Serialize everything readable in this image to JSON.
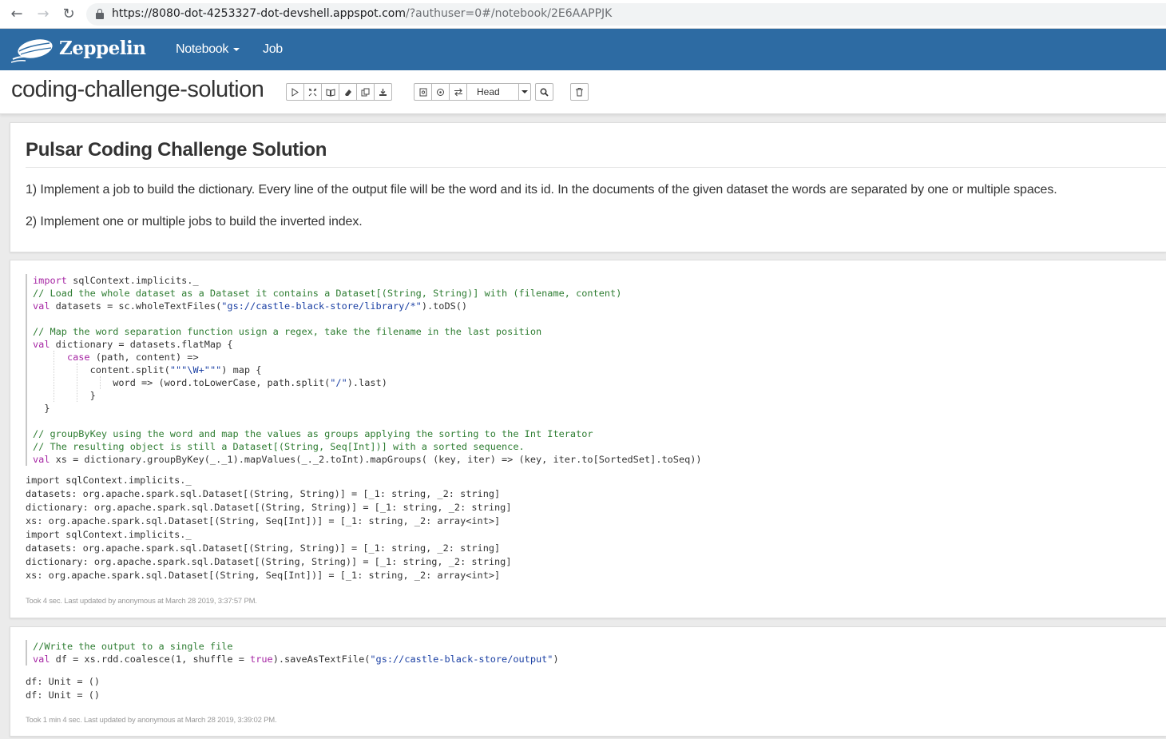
{
  "browser": {
    "url_host": "https://8080-dot-4253327-dot-devshell.appspot.com",
    "url_rest": "/?authuser=0#/notebook/2E6AAPPJK"
  },
  "navbar": {
    "brand": "Zeppelin",
    "menu": [
      {
        "label": "Notebook",
        "has_dropdown": true
      },
      {
        "label": "Job",
        "has_dropdown": false
      }
    ]
  },
  "notebook": {
    "title": "coding-challenge-solution",
    "toolbar": {
      "run_group": [
        "run-all-icon",
        "show-hide-code-icon",
        "show-hide-output-icon",
        "clear-output-icon",
        "clone-icon",
        "export-icon"
      ],
      "version_group": [
        "commit-icon",
        "revision-icon",
        "compare-icon"
      ],
      "version_selected": "Head",
      "search_icon": "search-icon",
      "trash_icon": "trash-icon"
    }
  },
  "paragraphs": [
    {
      "heading": "Pulsar Coding Challenge Solution",
      "lines": [
        "1) Implement a job to build the dictionary. Every line of the output file will be the word and its id. In the documents of the given dataset the words are separated by one or multiple spaces.",
        "2) Implement one or multiple jobs to build the inverted index."
      ]
    },
    {
      "code": [
        "import sqlContext.implicits._",
        "// Load the whole dataset as a Dataset it contains a Dataset[(String, String)] with (filename, content)",
        "val datasets = sc.wholeTextFiles(\"gs://castle-black-store/library/*\").toDS()",
        "",
        "// Map the word separation function usign a regex, take the filename in the last position",
        "val dictionary = datasets.flatMap {",
        "      case (path, content) =>",
        "          content.split(\"\"\"\\W+\"\"\") map {",
        "              word => (word.toLowerCase, path.split(\"/\").last)",
        "          }",
        "  }",
        "",
        "// groupByKey using the word and map the values as groups applying the sorting to the Int Iterator",
        "// The resulting object is still a Dataset[(String, Seq[Int])] with a sorted sequence.",
        "val xs = dictionary.groupByKey(_._1).mapValues(_._2.toInt).mapGroups( (key, iter) => (key, iter.to[SortedSet].toSeq))"
      ],
      "output": [
        "import sqlContext.implicits._",
        "datasets: org.apache.spark.sql.Dataset[(String, String)] = [_1: string, _2: string]",
        "dictionary: org.apache.spark.sql.Dataset[(String, String)] = [_1: string, _2: string]",
        "xs: org.apache.spark.sql.Dataset[(String, Seq[Int])] = [_1: string, _2: array<int>]",
        "import sqlContext.implicits._",
        "datasets: org.apache.spark.sql.Dataset[(String, String)] = [_1: string, _2: string]",
        "dictionary: org.apache.spark.sql.Dataset[(String, String)] = [_1: string, _2: string]",
        "xs: org.apache.spark.sql.Dataset[(String, Seq[Int])] = [_1: string, _2: array<int>]"
      ],
      "footer": "Took 4 sec. Last updated by anonymous at March 28 2019, 3:37:57 PM."
    },
    {
      "code": [
        "//Write the output to a single file",
        "val df = xs.rdd.coalesce(1, shuffle = true).saveAsTextFile(\"gs://castle-black-store/output\")"
      ],
      "output": [
        "df: Unit = ()",
        "df: Unit = ()"
      ],
      "footer": "Took 1 min 4 sec. Last updated by anonymous at March 28 2019, 3:39:02 PM."
    }
  ],
  "colors": {
    "navbar": "#2d6ba3",
    "keyword": "#a626a4",
    "comment": "#2e7d32",
    "string": "#1a3fa3"
  }
}
